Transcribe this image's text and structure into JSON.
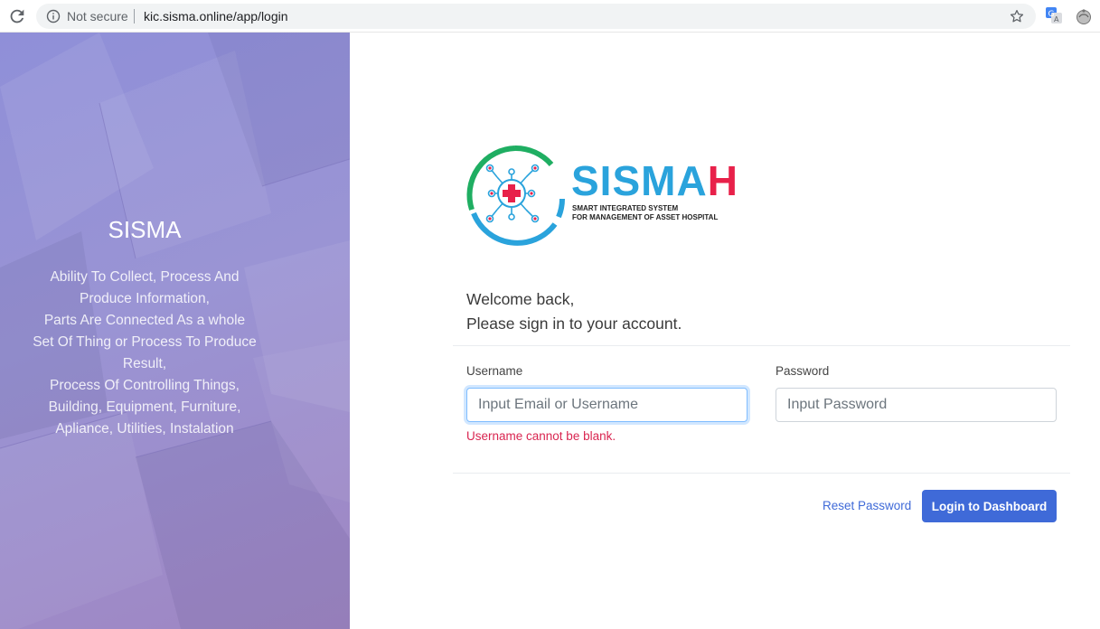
{
  "browser": {
    "security_label": "Not secure",
    "url": "kic.sisma.online/app/login"
  },
  "left_panel": {
    "title": "SISMA",
    "description_lines": [
      "Ability To Collect, Process And",
      "Produce Information,",
      "Parts Are Connected As a whole",
      "Set Of Thing or Process To Produce",
      "Result,",
      "Process Of Controlling Things,",
      "Building, Equipment, Furniture,",
      "Apliance, Utilities, Instalation"
    ]
  },
  "logo": {
    "title_main": "SISMA",
    "title_accent": "H",
    "subtitle_line1": "SMART INTEGRATED SYSTEM",
    "subtitle_line2": "FOR MANAGEMENT OF ASSET HOSPITAL"
  },
  "welcome": {
    "line1": "Welcome back,",
    "line2": "Please sign in to your account."
  },
  "form": {
    "username_label": "Username",
    "username_placeholder": "Input Email or Username",
    "username_error": "Username cannot be blank.",
    "password_label": "Password",
    "password_placeholder": "Input Password"
  },
  "actions": {
    "reset_label": "Reset Password",
    "login_label": "Login to Dashboard"
  },
  "colors": {
    "primary": "#3f6ad8",
    "error": "#d92550",
    "logo_blue": "#2aa3dc",
    "logo_red": "#e8214a"
  }
}
